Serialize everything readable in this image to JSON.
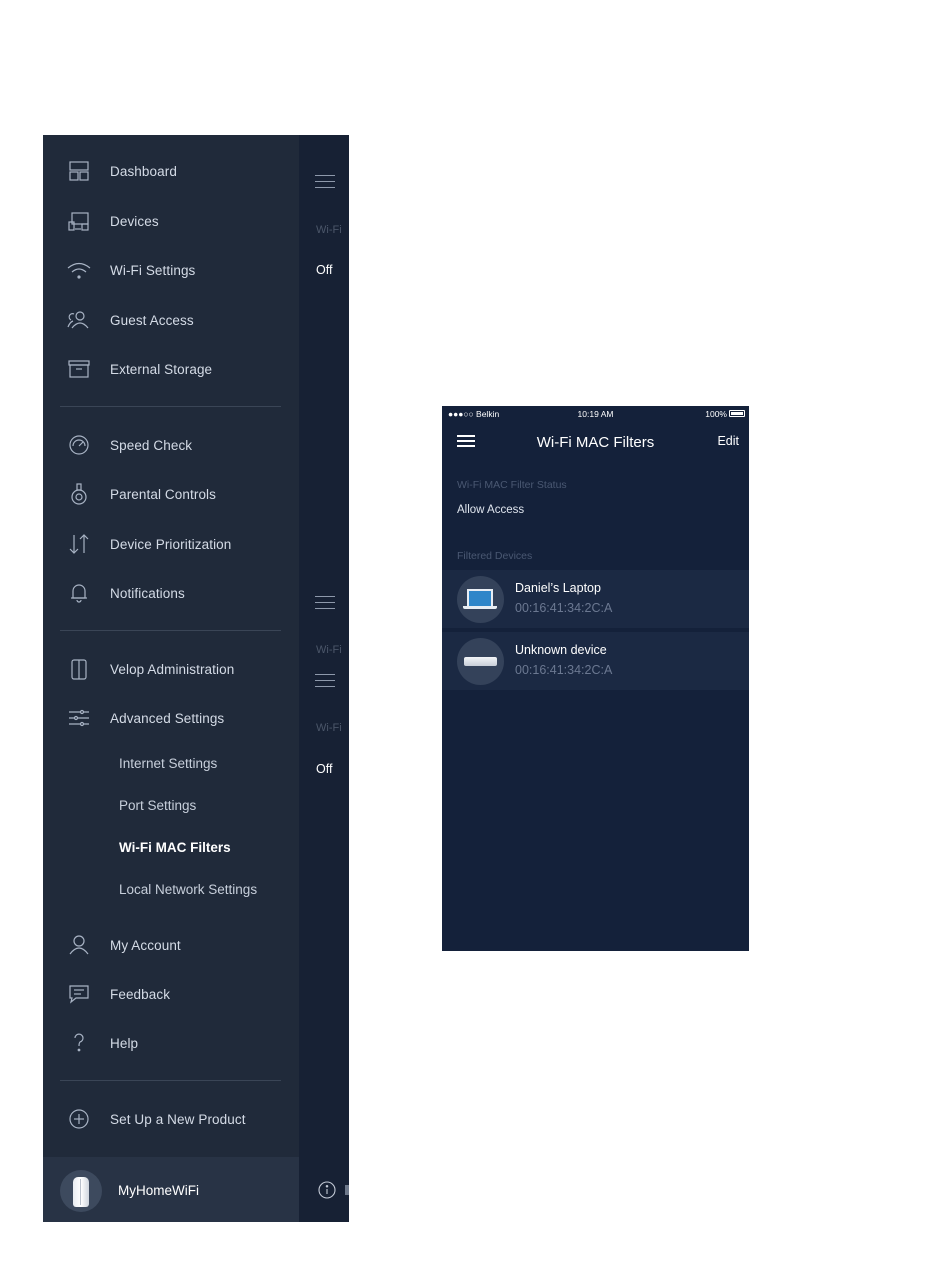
{
  "nav": {
    "items": [
      {
        "id": "dashboard",
        "label": "Dashboard",
        "icon": "dashboard-icon"
      },
      {
        "id": "devices",
        "label": "Devices",
        "icon": "devices-icon"
      },
      {
        "id": "wifi-settings",
        "label": "Wi-Fi Settings",
        "icon": "wifi-icon"
      },
      {
        "id": "guest-access",
        "label": "Guest Access",
        "icon": "guests-icon"
      },
      {
        "id": "external-storage",
        "label": "External Storage",
        "icon": "storage-icon"
      },
      {
        "id": "speed-check",
        "label": "Speed Check",
        "icon": "speedometer-icon"
      },
      {
        "id": "parental-controls",
        "label": "Parental Controls",
        "icon": "parental-controls-icon"
      },
      {
        "id": "device-prioritization",
        "label": "Device Prioritization",
        "icon": "prioritization-arrows-icon"
      },
      {
        "id": "notifications",
        "label": "Notifications",
        "icon": "bell-icon"
      },
      {
        "id": "velop-administration",
        "label": "Velop Administration",
        "icon": "velop-node-icon"
      },
      {
        "id": "advanced-settings",
        "label": "Advanced Settings",
        "icon": "sliders-icon"
      },
      {
        "id": "my-account",
        "label": "My Account",
        "icon": "user-icon"
      },
      {
        "id": "feedback",
        "label": "Feedback",
        "icon": "feedback-icon"
      },
      {
        "id": "help",
        "label": "Help",
        "icon": "question-mark-icon"
      },
      {
        "id": "set-up-new-product",
        "label": "Set Up a New Product",
        "icon": "plus-circle-icon"
      }
    ],
    "advanced_sub_items": [
      {
        "id": "internet-settings",
        "label": "Internet Settings",
        "active": false
      },
      {
        "id": "port-settings",
        "label": "Port Settings",
        "active": false
      },
      {
        "id": "wifi-mac-filters",
        "label": "Wi-Fi MAC Filters",
        "active": true
      },
      {
        "id": "local-network-settings",
        "label": "Local Network Settings",
        "active": false
      }
    ],
    "network_name": "MyHomeWiFi"
  },
  "peek": {
    "faint_label": "Wi-Fi",
    "value_top": "Off",
    "value_bottom": "Off"
  },
  "phone": {
    "status_bar": {
      "carrier": "●●●○○ Belkin",
      "time": "10:19 AM",
      "battery": "100%"
    },
    "title": "Wi-Fi MAC Filters",
    "edit_label": "Edit",
    "filter_status_label": "Wi-Fi MAC Filter Status",
    "filter_status_value": "Allow Access",
    "filtered_devices_label": "Filtered Devices",
    "devices": [
      {
        "name": "Daniel’s Laptop",
        "mac": "00:16:41:34:2C:A",
        "icon": "laptop-icon"
      },
      {
        "name": "Unknown device",
        "mac": "00:16:41:34:2C:A",
        "icon": "generic-device-icon"
      }
    ]
  },
  "colors": {
    "drawer_bg": "#202a3a",
    "screen_bg": "#172134",
    "phone_bg": "#14213a",
    "device_row_bg": "#1b2943",
    "active_text": "#ffffff",
    "muted_label": "#4a5872"
  }
}
